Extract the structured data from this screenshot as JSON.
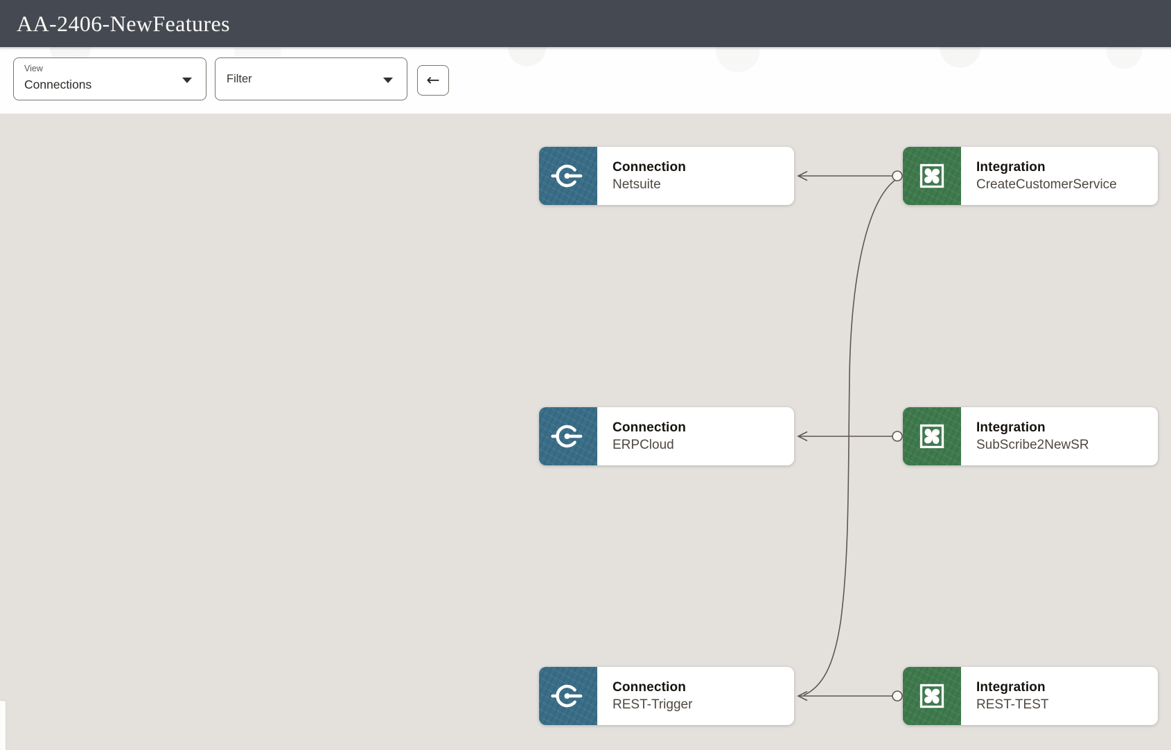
{
  "header": {
    "title": "AA-2406-NewFeatures"
  },
  "toolbar": {
    "view_label": "View",
    "view_value": "Connections",
    "filter_label": "Filter",
    "back_icon": "←"
  },
  "canvas": {
    "nodes": [
      {
        "type": "Connection",
        "name": "Netsuite"
      },
      {
        "type": "Connection",
        "name": "ERPCloud"
      },
      {
        "type": "Connection",
        "name": "REST-Trigger"
      },
      {
        "type": "Integration",
        "name": "CreateCustomerService"
      },
      {
        "type": "Integration",
        "name": "SubScribe2NewSR"
      },
      {
        "type": "Integration",
        "name": "REST-TEST"
      }
    ],
    "edges": [
      {
        "from": "CreateCustomerService",
        "to": "Netsuite"
      },
      {
        "from": "CreateCustomerService",
        "to": "REST-Trigger"
      },
      {
        "from": "SubScribe2NewSR",
        "to": "ERPCloud"
      },
      {
        "from": "REST-TEST",
        "to": "REST-Trigger"
      }
    ]
  },
  "colors": {
    "header_bg": "#454a52",
    "canvas_bg": "#e4e1dd",
    "connection_icon_bg": "#3a6e88",
    "integration_icon_bg": "#3f7a4d",
    "connector_line": "#5c5751"
  }
}
